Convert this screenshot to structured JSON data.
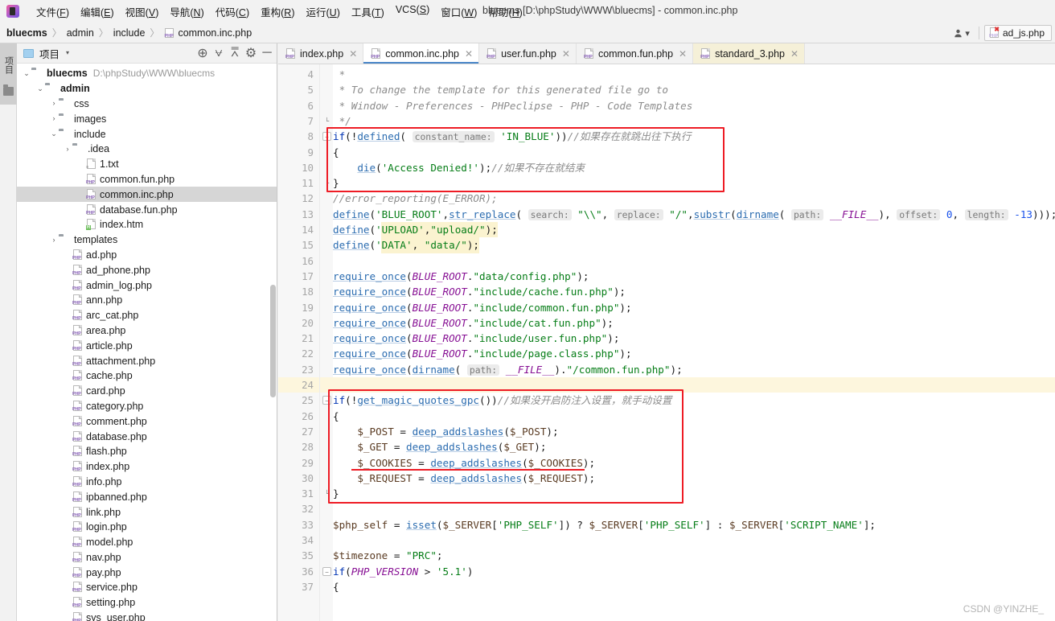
{
  "window": {
    "title": "bluecms [D:\\phpStudy\\WWW\\bluecms] - common.inc.php",
    "logo_name": "app-logo"
  },
  "menubar": [
    {
      "label": "文件(F)"
    },
    {
      "label": "编辑(E)"
    },
    {
      "label": "视图(V)"
    },
    {
      "label": "导航(N)"
    },
    {
      "label": "代码(C)"
    },
    {
      "label": "重构(R)"
    },
    {
      "label": "运行(U)"
    },
    {
      "label": "工具(T)"
    },
    {
      "label": "VCS(S)"
    },
    {
      "label": "窗口(W)"
    },
    {
      "label": "帮助(H)"
    }
  ],
  "breadcrumb": {
    "items": [
      "bluecms",
      "admin",
      "include"
    ],
    "file": "common.inc.php",
    "separator": "〉"
  },
  "topright": {
    "user_icon": "user-icon",
    "caret": "▾",
    "pinned_tab": "ad_js.php"
  },
  "toolstrip": {
    "label": "项目",
    "folder_icon": "folder-icon"
  },
  "project_panel": {
    "title": "项目",
    "caret": "▾",
    "tools": [
      {
        "name": "locate-icon",
        "glyph": "⊕"
      },
      {
        "name": "expand-all-icon",
        "glyph": "⩝"
      },
      {
        "name": "collapse-all-icon",
        "glyph": "⩞"
      },
      {
        "name": "settings-gear-icon",
        "glyph": "⚙"
      },
      {
        "name": "minimize-icon",
        "glyph": "─"
      }
    ]
  },
  "tree": [
    {
      "depth": 0,
      "twist": "⌄",
      "icon": "folder",
      "label": "bluecms",
      "bold": true,
      "path": "D:\\phpStudy\\WWW\\bluecms",
      "selected": false
    },
    {
      "depth": 1,
      "twist": "⌄",
      "icon": "folder",
      "label": "admin",
      "bold": true,
      "path": "",
      "selected": false
    },
    {
      "depth": 2,
      "twist": "›",
      "icon": "folder",
      "label": "css",
      "bold": false,
      "path": "",
      "selected": false
    },
    {
      "depth": 2,
      "twist": "›",
      "icon": "folder",
      "label": "images",
      "bold": false,
      "path": "",
      "selected": false
    },
    {
      "depth": 2,
      "twist": "⌄",
      "icon": "folder",
      "label": "include",
      "bold": false,
      "path": "",
      "selected": false
    },
    {
      "depth": 3,
      "twist": "›",
      "icon": "folder",
      "label": ".idea",
      "bold": false,
      "path": "",
      "selected": false
    },
    {
      "depth": 4,
      "twist": "",
      "icon": "txt",
      "label": "1.txt",
      "bold": false,
      "path": "",
      "selected": false
    },
    {
      "depth": 4,
      "twist": "",
      "icon": "php",
      "label": "common.fun.php",
      "bold": false,
      "path": "",
      "selected": false
    },
    {
      "depth": 4,
      "twist": "",
      "icon": "php",
      "label": "common.inc.php",
      "bold": false,
      "path": "",
      "selected": true
    },
    {
      "depth": 4,
      "twist": "",
      "icon": "php",
      "label": "database.fun.php",
      "bold": false,
      "path": "",
      "selected": false
    },
    {
      "depth": 4,
      "twist": "",
      "icon": "html",
      "label": "index.htm",
      "bold": false,
      "path": "",
      "selected": false
    },
    {
      "depth": 2,
      "twist": "›",
      "icon": "folder",
      "label": "templates",
      "bold": false,
      "path": "",
      "selected": false
    },
    {
      "depth": 3,
      "twist": "",
      "icon": "php",
      "label": "ad.php",
      "bold": false,
      "path": "",
      "selected": false
    },
    {
      "depth": 3,
      "twist": "",
      "icon": "php",
      "label": "ad_phone.php",
      "bold": false,
      "path": "",
      "selected": false
    },
    {
      "depth": 3,
      "twist": "",
      "icon": "php",
      "label": "admin_log.php",
      "bold": false,
      "path": "",
      "selected": false
    },
    {
      "depth": 3,
      "twist": "",
      "icon": "php",
      "label": "ann.php",
      "bold": false,
      "path": "",
      "selected": false
    },
    {
      "depth": 3,
      "twist": "",
      "icon": "php",
      "label": "arc_cat.php",
      "bold": false,
      "path": "",
      "selected": false
    },
    {
      "depth": 3,
      "twist": "",
      "icon": "php",
      "label": "area.php",
      "bold": false,
      "path": "",
      "selected": false
    },
    {
      "depth": 3,
      "twist": "",
      "icon": "php",
      "label": "article.php",
      "bold": false,
      "path": "",
      "selected": false
    },
    {
      "depth": 3,
      "twist": "",
      "icon": "php",
      "label": "attachment.php",
      "bold": false,
      "path": "",
      "selected": false
    },
    {
      "depth": 3,
      "twist": "",
      "icon": "php",
      "label": "cache.php",
      "bold": false,
      "path": "",
      "selected": false
    },
    {
      "depth": 3,
      "twist": "",
      "icon": "php",
      "label": "card.php",
      "bold": false,
      "path": "",
      "selected": false
    },
    {
      "depth": 3,
      "twist": "",
      "icon": "php",
      "label": "category.php",
      "bold": false,
      "path": "",
      "selected": false
    },
    {
      "depth": 3,
      "twist": "",
      "icon": "php",
      "label": "comment.php",
      "bold": false,
      "path": "",
      "selected": false
    },
    {
      "depth": 3,
      "twist": "",
      "icon": "php",
      "label": "database.php",
      "bold": false,
      "path": "",
      "selected": false
    },
    {
      "depth": 3,
      "twist": "",
      "icon": "php",
      "label": "flash.php",
      "bold": false,
      "path": "",
      "selected": false
    },
    {
      "depth": 3,
      "twist": "",
      "icon": "php",
      "label": "index.php",
      "bold": false,
      "path": "",
      "selected": false
    },
    {
      "depth": 3,
      "twist": "",
      "icon": "php",
      "label": "info.php",
      "bold": false,
      "path": "",
      "selected": false
    },
    {
      "depth": 3,
      "twist": "",
      "icon": "php",
      "label": "ipbanned.php",
      "bold": false,
      "path": "",
      "selected": false
    },
    {
      "depth": 3,
      "twist": "",
      "icon": "php",
      "label": "link.php",
      "bold": false,
      "path": "",
      "selected": false
    },
    {
      "depth": 3,
      "twist": "",
      "icon": "php",
      "label": "login.php",
      "bold": false,
      "path": "",
      "selected": false
    },
    {
      "depth": 3,
      "twist": "",
      "icon": "php",
      "label": "model.php",
      "bold": false,
      "path": "",
      "selected": false
    },
    {
      "depth": 3,
      "twist": "",
      "icon": "php",
      "label": "nav.php",
      "bold": false,
      "path": "",
      "selected": false
    },
    {
      "depth": 3,
      "twist": "",
      "icon": "php",
      "label": "pay.php",
      "bold": false,
      "path": "",
      "selected": false
    },
    {
      "depth": 3,
      "twist": "",
      "icon": "php",
      "label": "service.php",
      "bold": false,
      "path": "",
      "selected": false
    },
    {
      "depth": 3,
      "twist": "",
      "icon": "php",
      "label": "setting.php",
      "bold": false,
      "path": "",
      "selected": false
    },
    {
      "depth": 3,
      "twist": "",
      "icon": "php",
      "label": "sys_user.php",
      "bold": false,
      "path": "",
      "selected": false
    }
  ],
  "editor_tabs": [
    {
      "label": "index.php",
      "active": false,
      "tinted": false
    },
    {
      "label": "common.inc.php",
      "active": true,
      "tinted": false
    },
    {
      "label": "user.fun.php",
      "active": false,
      "tinted": false
    },
    {
      "label": "common.fun.php",
      "active": false,
      "tinted": false
    },
    {
      "label": "standard_3.php",
      "active": false,
      "tinted": true
    }
  ],
  "editor": {
    "first_line": 4,
    "last_line": 37,
    "caret_line": 24,
    "lines": [
      {
        "n": 4,
        "fold": "",
        "text": " *"
      },
      {
        "n": 5,
        "fold": "",
        "text": " * To change the template for this generated file go to"
      },
      {
        "n": 6,
        "fold": "",
        "text": " * Window - Preferences - PHPeclipse - PHP - Code Templates"
      },
      {
        "n": 7,
        "fold": "end",
        "text": " */"
      },
      {
        "n": 8,
        "fold": "minus",
        "text": "if(!defined( constant_name: 'IN_BLUE'))//如果存在就跳出往下执行"
      },
      {
        "n": 9,
        "fold": "",
        "text": "{"
      },
      {
        "n": 10,
        "fold": "",
        "text": "    die('Access Denied!');//如果不存在就结束"
      },
      {
        "n": 11,
        "fold": "end",
        "text": "}"
      },
      {
        "n": 12,
        "fold": "",
        "text": "//error_reporting(E_ERROR);"
      },
      {
        "n": 13,
        "fold": "",
        "text": "define('BLUE_ROOT',str_replace( search: \"\\\\\", replace: \"/\",substr(dirname( path: __FILE__), offset: 0, length: -13)));"
      },
      {
        "n": 14,
        "fold": "",
        "text": "define('UPLOAD',\"upload/\");"
      },
      {
        "n": 15,
        "fold": "",
        "text": "define('DATA', \"data/\");"
      },
      {
        "n": 16,
        "fold": "",
        "text": ""
      },
      {
        "n": 17,
        "fold": "",
        "text": "require_once(BLUE_ROOT.\"data/config.php\");"
      },
      {
        "n": 18,
        "fold": "",
        "text": "require_once(BLUE_ROOT.\"include/cache.fun.php\");"
      },
      {
        "n": 19,
        "fold": "",
        "text": "require_once(BLUE_ROOT.\"include/common.fun.php\");"
      },
      {
        "n": 20,
        "fold": "",
        "text": "require_once(BLUE_ROOT.\"include/cat.fun.php\");"
      },
      {
        "n": 21,
        "fold": "",
        "text": "require_once(BLUE_ROOT.\"include/user.fun.php\");"
      },
      {
        "n": 22,
        "fold": "",
        "text": "require_once(BLUE_ROOT.\"include/page.class.php\");"
      },
      {
        "n": 23,
        "fold": "",
        "text": "require_once(dirname( path: __FILE__).\"/common.fun.php\");"
      },
      {
        "n": 24,
        "fold": "",
        "text": ""
      },
      {
        "n": 25,
        "fold": "minus",
        "text": "if(!get_magic_quotes_gpc())//如果没开启防注入设置，就手动设置"
      },
      {
        "n": 26,
        "fold": "",
        "text": "{"
      },
      {
        "n": 27,
        "fold": "",
        "text": "    $_POST = deep_addslashes($_POST);"
      },
      {
        "n": 28,
        "fold": "",
        "text": "    $_GET = deep_addslashes($_GET);"
      },
      {
        "n": 29,
        "fold": "",
        "text": "    $_COOKIES = deep_addslashes($_COOKIES);"
      },
      {
        "n": 30,
        "fold": "",
        "text": "    $_REQUEST = deep_addslashes($_REQUEST);"
      },
      {
        "n": 31,
        "fold": "end",
        "text": "}"
      },
      {
        "n": 32,
        "fold": "",
        "text": ""
      },
      {
        "n": 33,
        "fold": "",
        "text": "$php_self = isset($_SERVER['PHP_SELF']) ? $_SERVER['PHP_SELF'] : $_SERVER['SCRIPT_NAME'];"
      },
      {
        "n": 34,
        "fold": "",
        "text": ""
      },
      {
        "n": 35,
        "fold": "",
        "text": "$timezone = \"PRC\";"
      },
      {
        "n": 36,
        "fold": "minus",
        "text": "if(PHP_VERSION > '5.1')"
      },
      {
        "n": 37,
        "fold": "",
        "text": "{"
      }
    ]
  },
  "annotations": {
    "box1_lines": [
      8,
      11
    ],
    "box2_lines": [
      25,
      31
    ],
    "underline_line": 29,
    "color": "#ee1c25"
  },
  "watermark": "CSDN @YINZHE_"
}
